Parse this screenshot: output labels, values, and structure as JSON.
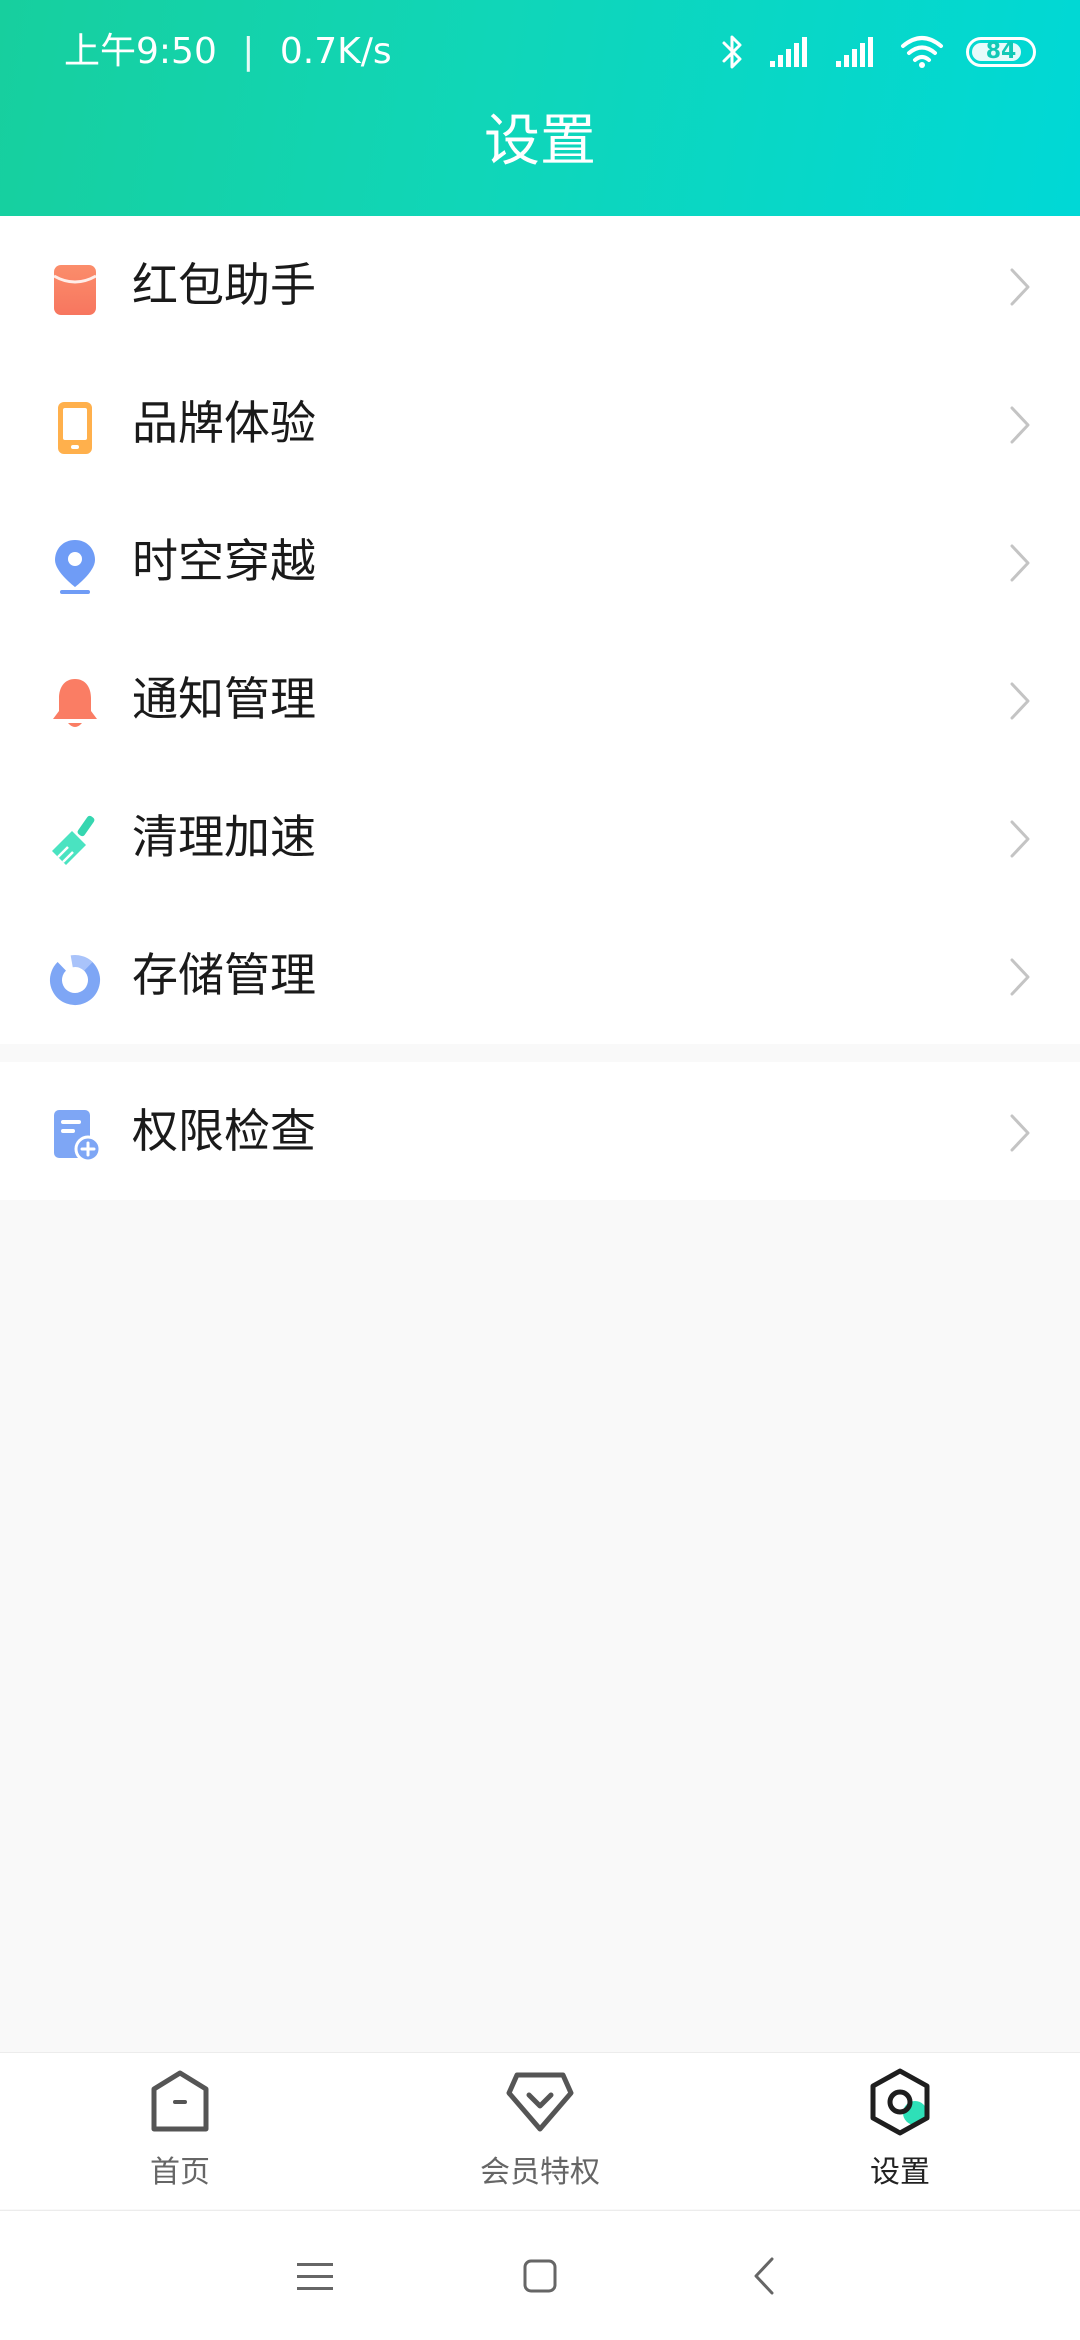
{
  "status_bar": {
    "time": "上午9:50",
    "separator": "|",
    "speed": "0.7K/s",
    "battery": "84",
    "battery_level": 0.84
  },
  "header": {
    "title": "设置"
  },
  "menu": {
    "items": [
      {
        "label": "红包助手",
        "icon": "red-envelope-icon"
      },
      {
        "label": "品牌体验",
        "icon": "phone-icon"
      },
      {
        "label": "时空穿越",
        "icon": "location-pin-icon"
      },
      {
        "label": "通知管理",
        "icon": "bell-icon"
      },
      {
        "label": "清理加速",
        "icon": "broom-icon"
      },
      {
        "label": "存储管理",
        "icon": "storage-pie-icon"
      }
    ],
    "secondary": [
      {
        "label": "权限检查",
        "icon": "permission-doc-icon"
      }
    ]
  },
  "bottom_nav": {
    "items": [
      {
        "label": "首页",
        "icon": "home-icon",
        "active": false
      },
      {
        "label": "会员特权",
        "icon": "vip-icon",
        "active": false
      },
      {
        "label": "设置",
        "icon": "settings-icon",
        "active": true
      }
    ]
  },
  "system_nav": {
    "buttons": [
      "menu-icon",
      "home-square-icon",
      "back-icon"
    ]
  },
  "colors": {
    "header_start": "#17cf9e",
    "header_end": "#00d8d6",
    "accent_teal": "#2ee0b8",
    "icon_red": "#f97a6a",
    "icon_orange": "#ffb74d",
    "icon_blue": "#7ea6f5"
  }
}
